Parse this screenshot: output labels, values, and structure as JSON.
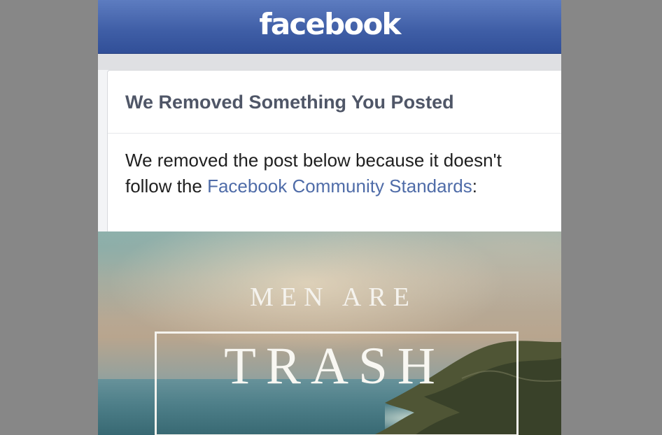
{
  "colors": {
    "page_background": "#878787",
    "header_blue": "#3f5ea6",
    "title_text": "#4f5667",
    "link_blue": "#4f6ca8"
  },
  "header": {
    "brand": "facebook"
  },
  "notice": {
    "title": "We Removed Something You Posted",
    "message_start": "We removed the post below because it doesn't follow the ",
    "link_text": "Facebook Community Standards",
    "message_end": ":"
  },
  "post": {
    "subtitle": "MEN ARE",
    "title": "TRASH"
  }
}
